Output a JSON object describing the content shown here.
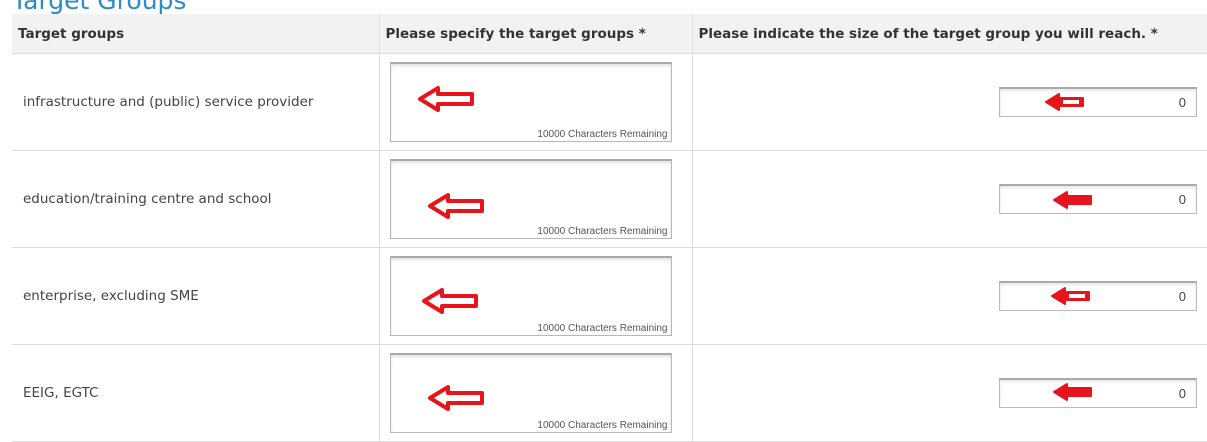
{
  "section_title": "Target Groups",
  "table": {
    "headers": [
      "Target groups",
      "Please specify the target groups *",
      "Please indicate the size of the target group you will reach. *"
    ],
    "rows": [
      {
        "name": "infrastructure and (public) service provider",
        "chars_remaining": "10000 Characters Remaining",
        "size": "0"
      },
      {
        "name": "education/training centre and school",
        "chars_remaining": "10000 Characters Remaining",
        "size": "0"
      },
      {
        "name": "enterprise, excluding SME",
        "chars_remaining": "10000 Characters Remaining",
        "size": "0"
      },
      {
        "name": "EEIG, EGTC",
        "chars_remaining": "10000 Characters Remaining",
        "size": "0"
      }
    ]
  },
  "annotation": {
    "icon": "left-arrow-icon",
    "color": "#e8141b"
  }
}
